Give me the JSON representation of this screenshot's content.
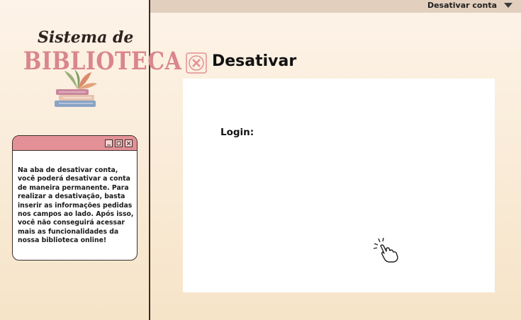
{
  "sidebar": {
    "logo": {
      "line1": "Sistema de",
      "line2": "BIBLIOTECA",
      "icon": "book-stack-icon"
    },
    "info_window": {
      "text": "Na aba de desativar conta, você poderá desativar a conta de maneira permanente. Para realizar a desativação, basta inserir as informações pedidas nos campos ao lado. Após isso, você não conseguirá acessar mais as funcionalidades da nossa biblioteca online!"
    }
  },
  "topbar": {
    "account_menu_label": "Desativar conta"
  },
  "main": {
    "heading": "Desativar",
    "login_label": "Login:"
  },
  "colors": {
    "accent_pink": "#e39096",
    "logo_pink": "#d9868d",
    "topbar": "#e2cfbd",
    "background": "#fdf3e8"
  }
}
